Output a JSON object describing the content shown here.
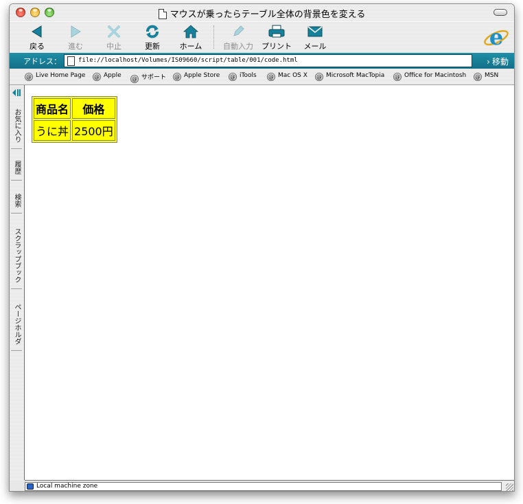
{
  "window": {
    "title": "マウスが乗ったらテーブル全体の背景色を変える"
  },
  "toolbar": {
    "back": "戻る",
    "forward": "進む",
    "stop": "中止",
    "refresh": "更新",
    "home": "ホーム",
    "autofill": "自動入力",
    "print": "プリント",
    "mail": "メール"
  },
  "address": {
    "label": "アドレス：",
    "url": "file://localhost/Volumes/IS09660/script/table/001/code.html",
    "go": "移動"
  },
  "favorites": [
    "Live Home Page",
    "Apple",
    "サポート",
    "Apple Store",
    "iTools",
    "Mac OS X",
    "Microsoft MacTopia",
    "Office for Macintosh",
    "MSN"
  ],
  "sidebar": {
    "tabs": [
      "お気に入り",
      "履歴",
      "検索",
      "スクラップブック",
      "ページホルダ"
    ]
  },
  "table": {
    "headers": [
      "商品名",
      "価格"
    ],
    "rows": [
      [
        "うに丼",
        "2500円"
      ]
    ]
  },
  "status": {
    "zone": "Local machine zone"
  },
  "colors": {
    "table_bg": "#ffff00",
    "address_bar": "#1a88a2",
    "icon_teal": "#17809a"
  }
}
